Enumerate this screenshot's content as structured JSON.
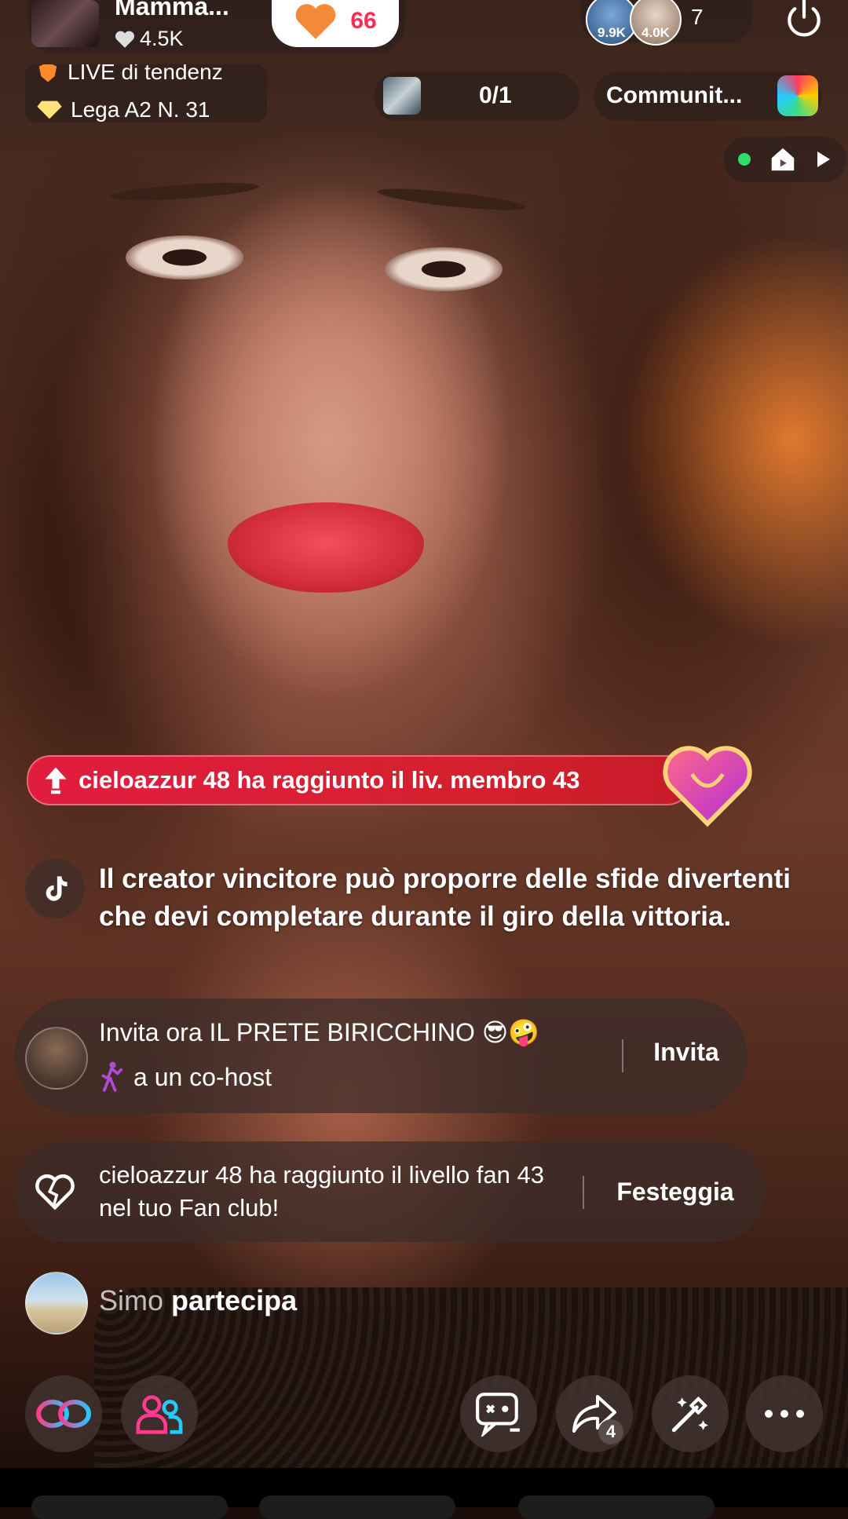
{
  "host": {
    "name": "Mamma...",
    "likes": "4.5K",
    "like_button_count": "66"
  },
  "badges": {
    "line1": "LIVE di tendenz",
    "line2": "Lega A2 N. 31"
  },
  "viewers": {
    "top1_score": "9.9K",
    "top2_score": "4.0K",
    "count": "7"
  },
  "goal": {
    "progress": "0/1"
  },
  "community": {
    "label": "Communit..."
  },
  "chat": {
    "level_banner": "cieloazzur 48 ha raggiunto il liv. membro 43",
    "system_message": "Il creator vincitore può proporre delle sfide divertenti che devi completare durante il giro della vittoria.",
    "invite": {
      "line1": "Invita ora IL PRETE BIRICCHINO 😎🤪",
      "line2": "a un co-host",
      "button": "Invita"
    },
    "fan_club": {
      "text": "cieloazzur 48 ha raggiunto il livello fan 43 nel tuo Fan club!",
      "button": "Festeggia"
    },
    "join": {
      "user": "Simo",
      "action": "partecipa"
    }
  },
  "action_bar": {
    "share_count": "4"
  },
  "colors": {
    "accent_red": "#fe2c55",
    "banner_red": "#e11d3f",
    "live_green": "#2ee06b"
  }
}
